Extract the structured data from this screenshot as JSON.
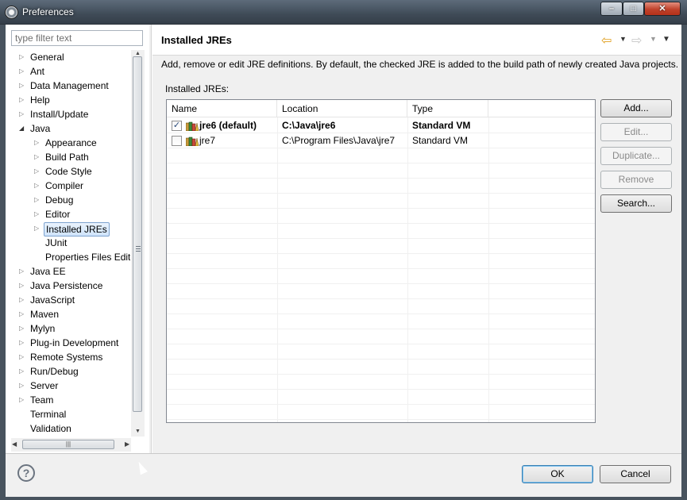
{
  "window": {
    "title": "Preferences",
    "minimize": "–",
    "maximize": "□",
    "close": "✕"
  },
  "sidebar": {
    "filter_placeholder": "type filter text",
    "items": [
      {
        "label": "General",
        "level": 0,
        "expander": "closed"
      },
      {
        "label": "Ant",
        "level": 0,
        "expander": "closed"
      },
      {
        "label": "Data Management",
        "level": 0,
        "expander": "closed"
      },
      {
        "label": "Help",
        "level": 0,
        "expander": "closed"
      },
      {
        "label": "Install/Update",
        "level": 0,
        "expander": "closed"
      },
      {
        "label": "Java",
        "level": 0,
        "expander": "open"
      },
      {
        "label": "Appearance",
        "level": 1,
        "expander": "closed"
      },
      {
        "label": "Build Path",
        "level": 1,
        "expander": "closed"
      },
      {
        "label": "Code Style",
        "level": 1,
        "expander": "closed"
      },
      {
        "label": "Compiler",
        "level": 1,
        "expander": "closed"
      },
      {
        "label": "Debug",
        "level": 1,
        "expander": "closed"
      },
      {
        "label": "Editor",
        "level": 1,
        "expander": "closed"
      },
      {
        "label": "Installed JREs",
        "level": 1,
        "expander": "closed",
        "selected": true
      },
      {
        "label": "JUnit",
        "level": 1,
        "expander": "none"
      },
      {
        "label": "Properties Files Editor",
        "level": 1,
        "expander": "none"
      },
      {
        "label": "Java EE",
        "level": 0,
        "expander": "closed"
      },
      {
        "label": "Java Persistence",
        "level": 0,
        "expander": "closed"
      },
      {
        "label": "JavaScript",
        "level": 0,
        "expander": "closed"
      },
      {
        "label": "Maven",
        "level": 0,
        "expander": "closed"
      },
      {
        "label": "Mylyn",
        "level": 0,
        "expander": "closed"
      },
      {
        "label": "Plug-in Development",
        "level": 0,
        "expander": "closed"
      },
      {
        "label": "Remote Systems",
        "level": 0,
        "expander": "closed"
      },
      {
        "label": "Run/Debug",
        "level": 0,
        "expander": "closed"
      },
      {
        "label": "Server",
        "level": 0,
        "expander": "closed"
      },
      {
        "label": "Team",
        "level": 0,
        "expander": "closed"
      },
      {
        "label": "Terminal",
        "level": 0,
        "expander": "none"
      },
      {
        "label": "Validation",
        "level": 0,
        "expander": "none"
      }
    ]
  },
  "page": {
    "title": "Installed JREs",
    "description": "Add, remove or edit JRE definitions. By default, the checked JRE is added to the build path of newly created Java projects.",
    "list_label": "Installed JREs:",
    "columns": [
      "Name",
      "Location",
      "Type"
    ],
    "rows": [
      {
        "name": "jre6 (default)",
        "location": "C:\\Java\\jre6",
        "type": "Standard VM",
        "checked": true,
        "bold": true
      },
      {
        "name": "jre7",
        "location": "C:\\Program Files\\Java\\jre7",
        "type": "Standard VM",
        "checked": false,
        "bold": false
      }
    ],
    "buttons": [
      {
        "label": "Add...",
        "enabled": true
      },
      {
        "label": "Edit...",
        "enabled": false
      },
      {
        "label": "Duplicate...",
        "enabled": false
      },
      {
        "label": "Remove",
        "enabled": false
      },
      {
        "label": "Search...",
        "enabled": true
      }
    ]
  },
  "footer": {
    "help": "?",
    "ok": "OK",
    "cancel": "Cancel"
  },
  "icons": {
    "app": "preferences-gear-icon",
    "back": "back-arrow-icon",
    "forward": "forward-arrow-icon",
    "menu": "view-menu-icon",
    "jre": "jre-library-icon",
    "help": "help-icon"
  },
  "colors": {
    "selection_border": "#7da2ce",
    "selection_fill": "#cfe4fb",
    "back_arrow": "#e0a020",
    "close_button": "#c0422b"
  }
}
